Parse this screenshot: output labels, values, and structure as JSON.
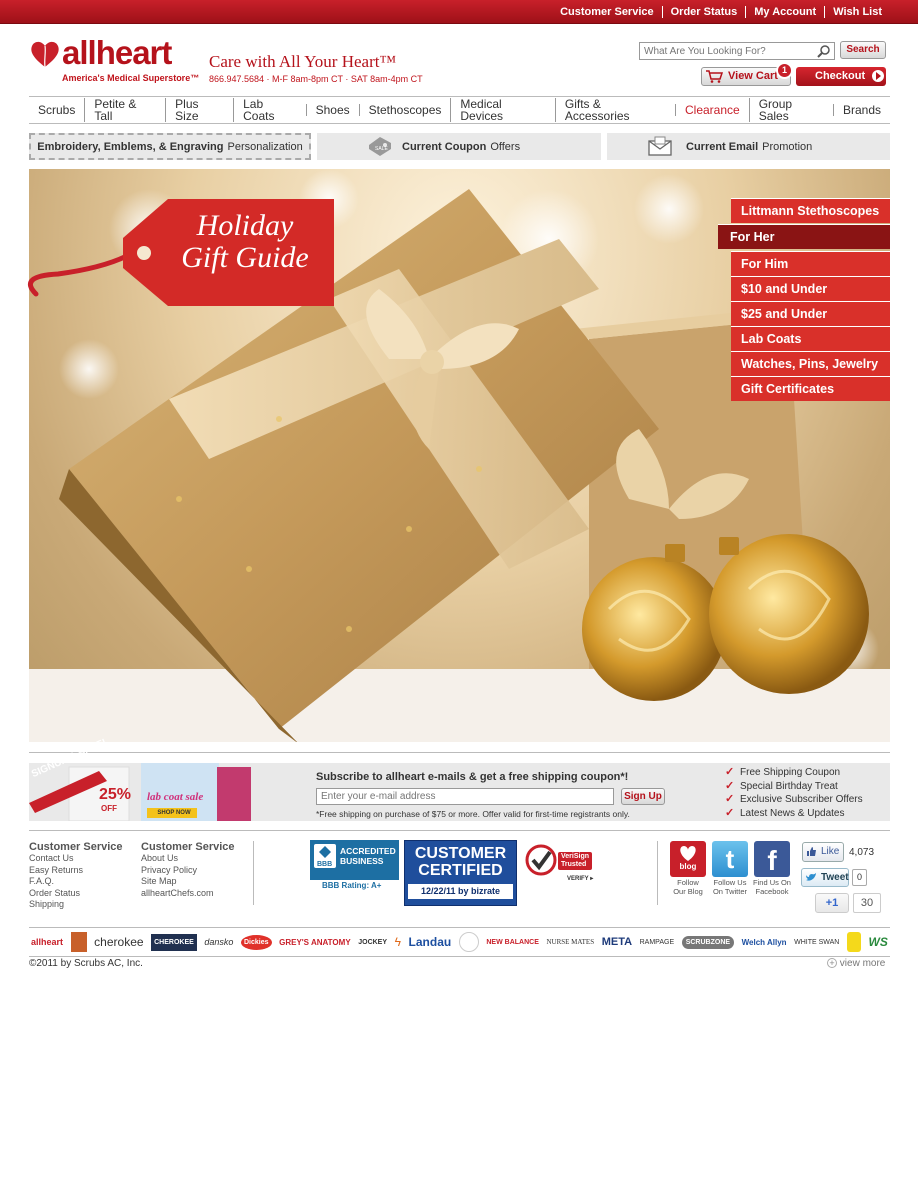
{
  "top_links": [
    "Customer Service",
    "Order Status",
    "My Account",
    "Wish List"
  ],
  "brand": {
    "name": "allheart",
    "tagline": "America's Medical Superstore™",
    "slogan": "Care with All Your Heart™",
    "phone_hours": "866.947.5684 · M-F 8am-8pm CT · SAT 8am-4pm CT"
  },
  "search": {
    "placeholder": "What Are You Looking For?",
    "button": "Search"
  },
  "cart": {
    "view_label": "View Cart",
    "count": "1",
    "checkout_label": "Checkout"
  },
  "nav": [
    "Scrubs",
    "Petite & Tall",
    "Plus Size",
    "Lab Coats",
    "Shoes",
    "Stethoscopes",
    "Medical Devices",
    "Gifts & Accessories",
    "Clearance",
    "Group Sales",
    "Brands"
  ],
  "promos": {
    "embroidery": {
      "bold": "Embroidery, Emblems, & Engraving",
      "rest": "Personalization"
    },
    "coupon": {
      "bold": "Current Coupon",
      "rest": "Offers"
    },
    "email": {
      "bold": "Current Email",
      "rest": "Promotion"
    }
  },
  "hero": {
    "tag_line1": "Holiday",
    "tag_line2": "Gift Guide",
    "menu": [
      {
        "label": "Littmann Stethoscopes",
        "active": false
      },
      {
        "label": "For Her",
        "active": true
      },
      {
        "label": "For Him",
        "active": false
      },
      {
        "label": "$10 and Under",
        "active": false
      },
      {
        "label": "$25 and Under",
        "active": false
      },
      {
        "label": "Lab Coats",
        "active": false
      },
      {
        "label": "Watches, Pins, Jewelry",
        "active": false
      },
      {
        "label": "Gift Certificates",
        "active": false
      }
    ]
  },
  "subscribe": {
    "banner_line": "SIGNUP & SAVE!",
    "banner_sale": "lab coat sale",
    "banner_pct": "25%",
    "banner_off": "OFF",
    "banner_shop": "SHOP NOW",
    "title": "Subscribe to allheart e-mails & get a free shipping coupon*!",
    "placeholder": "Enter your e-mail address",
    "button": "Sign Up",
    "note": "*Free shipping on purchase of $75 or more. Offer valid for first-time registrants only.",
    "benefits": [
      "Free Shipping Coupon",
      "Special Birthday Treat",
      "Exclusive Subscriber Offers",
      "Latest News & Updates"
    ]
  },
  "footer": {
    "col1": {
      "title": "Customer Service",
      "links": [
        "Contact Us",
        "Easy Returns",
        "F.A.Q.",
        "Order Status",
        "Shipping"
      ]
    },
    "col2": {
      "title": "Customer Service",
      "links": [
        "About Us",
        "Privacy Policy",
        "Site Map",
        "allheartChefs.com"
      ]
    },
    "bbb": {
      "line1": "ACCREDITED",
      "line2": "BUSINESS",
      "rating": "BBB Rating: A+"
    },
    "certified": {
      "line1": "CUSTOMER",
      "line2": "CERTIFIED",
      "date": "12/22/11 by bizrate"
    },
    "verisign": {
      "line1": "VeriSign",
      "line2": "Trusted",
      "verify": "VERIFY ▸"
    },
    "social": [
      {
        "label": "blog",
        "caption1": "Follow",
        "caption2": "Our Blog"
      },
      {
        "label": "t",
        "caption1": "Follow Us",
        "caption2": "On Twitter"
      },
      {
        "label": "f",
        "caption1": "Find Us On",
        "caption2": "Facebook"
      }
    ],
    "like_label": "Like",
    "like_count": "4,073",
    "tweet_label": "Tweet",
    "tweet_count": "0",
    "plus_label": "+1",
    "plus_count": "30",
    "brands": [
      "allheart",
      "cherokee",
      "CHEROKEE",
      "dansko",
      "Dickies",
      "GREY'S ANATOMY",
      "JOCKEY",
      "Landau",
      "NEW BALANCE",
      "NURSE MATES",
      "META",
      "RAMPAGE",
      "SCRUBZONE",
      "Welch Allyn",
      "WHITE SWAN",
      "WS"
    ],
    "copyright": "©2011 by Scrubs AC, Inc.",
    "view_more": "view more"
  },
  "colors": {
    "brand_red": "#c8202a",
    "dark_red": "#8a1414",
    "gray_band": "#e9e9e9"
  }
}
